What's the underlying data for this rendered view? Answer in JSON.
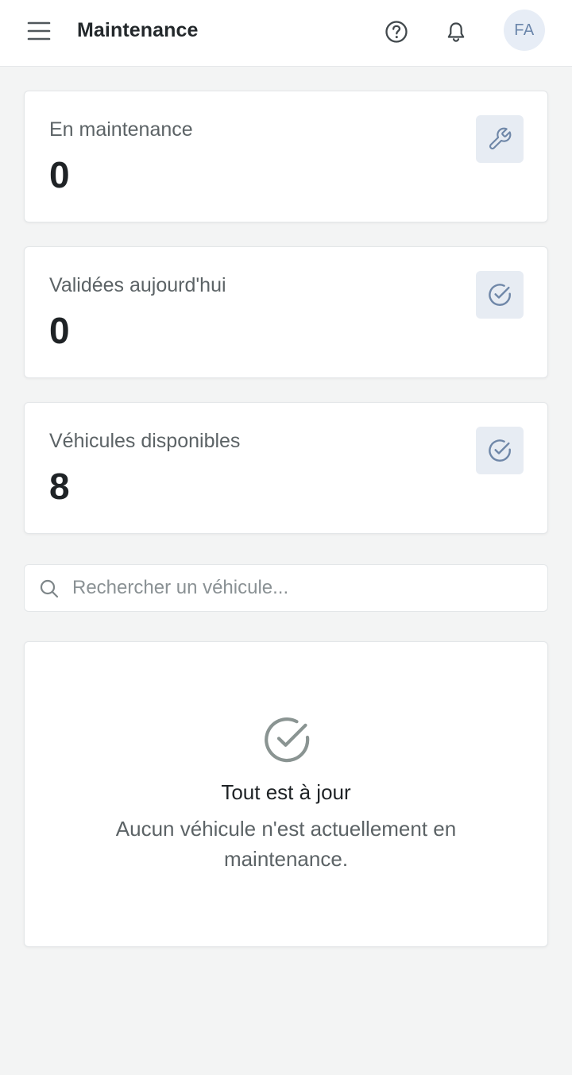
{
  "header": {
    "title": "Maintenance",
    "menu_icon": "hamburger-menu-icon",
    "help_icon": "question-circle-icon",
    "notifications_icon": "bell-icon",
    "avatar_initials": "FA"
  },
  "stats": [
    {
      "label": "En maintenance",
      "value": "0",
      "icon": "wrench-icon"
    },
    {
      "label": "Validées aujourd'hui",
      "value": "0",
      "icon": "check-circle-icon"
    },
    {
      "label": "Véhicules disponibles",
      "value": "8",
      "icon": "check-circle-icon"
    }
  ],
  "search": {
    "placeholder": "Rechercher un véhicule...",
    "value": "",
    "icon": "search-icon"
  },
  "empty_state": {
    "icon": "check-circle-icon",
    "title": "Tout est à jour",
    "text": "Aucun véhicule n'est actuellement en maintenance."
  },
  "colors": {
    "background": "#f3f4f4",
    "card": "#ffffff",
    "icon_box_bg": "#e7ecf3",
    "icon_accent": "#6f87a8",
    "avatar_bg": "#e7edf6",
    "avatar_text": "#6b86ab",
    "empty_icon": "#8a9492"
  }
}
